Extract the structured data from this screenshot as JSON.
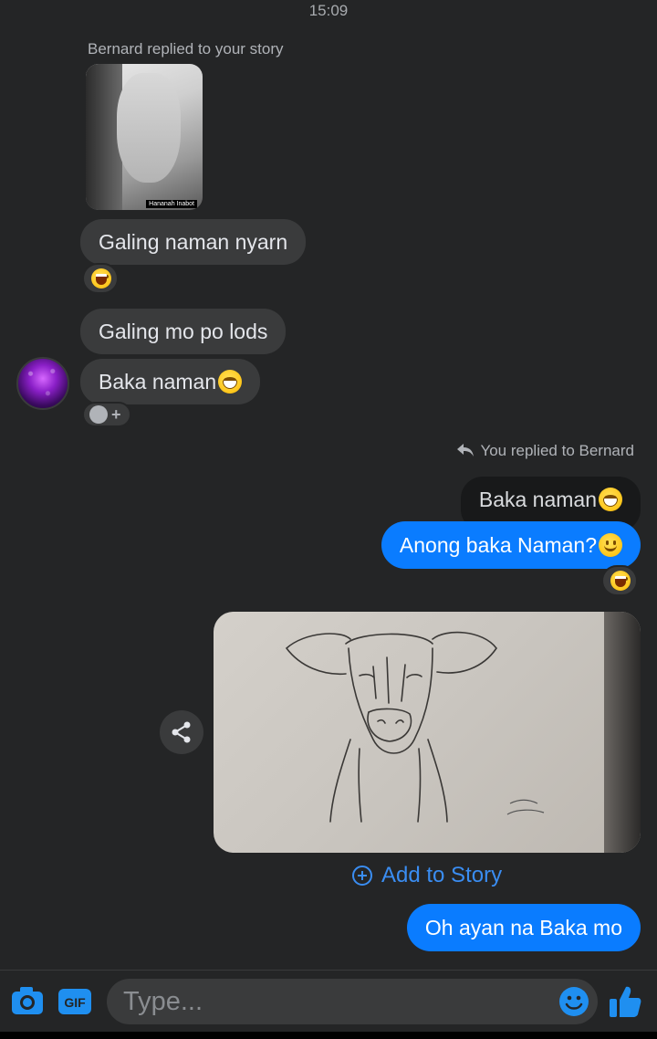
{
  "time": "15:09",
  "story_reply_meta": "Bernard replied to your story",
  "story_thumb_caption": "Hananah Inabot",
  "messages_in": [
    "Galing naman nyarn",
    "Galing mo po lods",
    "Baka naman"
  ],
  "you_replied_meta": "You replied to Bernard",
  "quoted_message": "Baka naman",
  "messages_out": [
    "Anong baka Naman?",
    "Oh ayan na Baka mo"
  ],
  "add_to_story": "Add to Story",
  "composer": {
    "placeholder": "Type..."
  },
  "colors": {
    "background": "#242526",
    "bubble_in": "#3a3b3c",
    "bubble_out": "#0a7cff",
    "accent": "#3a8df2"
  },
  "icons": [
    "camera-icon",
    "gif-icon",
    "emoji-icon",
    "like-icon",
    "share-icon",
    "reply-icon",
    "add-circle-icon"
  ]
}
